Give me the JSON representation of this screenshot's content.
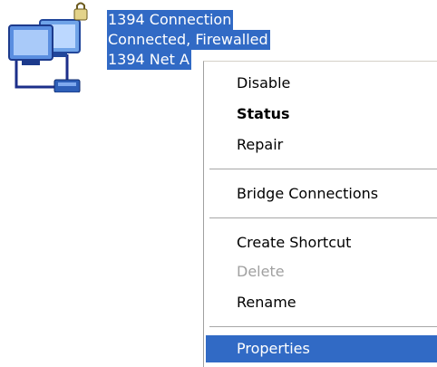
{
  "connection": {
    "icon": "network-connection-icon",
    "name": "1394 Connection",
    "status": "Connected, Firewalled",
    "device": "1394 Net A"
  },
  "context_menu": {
    "disable": "Disable",
    "status": "Status",
    "repair": "Repair",
    "bridge": "Bridge Connections",
    "create_shortcut": "Create Shortcut",
    "delete": "Delete",
    "rename": "Rename",
    "properties": "Properties"
  },
  "colors": {
    "selection": "#316ac5",
    "disabled_text": "#a0a0a0"
  }
}
